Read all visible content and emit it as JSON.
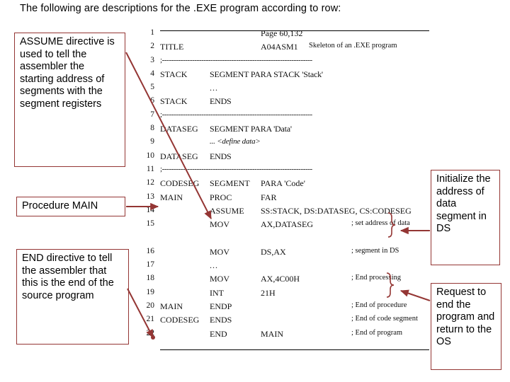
{
  "slide": {
    "title": "The following are descriptions for the .EXE program according to row:",
    "accent_color": "#943634",
    "text_color": "#000000",
    "background_color": "#ffffff"
  },
  "code_listing": {
    "rows": [
      {
        "num": "1",
        "label": "",
        "op": "",
        "arg": "Page 60,132",
        "comment": ""
      },
      {
        "num": "2",
        "label": "TITLE",
        "op": "",
        "arg": "A04ASM1",
        "comment": "Skeleton of an .EXE program"
      },
      {
        "num": "3",
        "label": ";",
        "op": "divider",
        "arg": "",
        "comment": ""
      },
      {
        "num": "4",
        "label": "STACK",
        "op": "",
        "arg": "SEGMENT PARA STACK 'Stack'",
        "comment": ""
      },
      {
        "num": "5",
        "label": "",
        "op": "",
        "arg": "...",
        "comment": ""
      },
      {
        "num": "6",
        "label": "STACK",
        "op": "",
        "arg": "ENDS",
        "comment": ""
      },
      {
        "num": "7",
        "label": ";",
        "op": "divider",
        "arg": "",
        "comment": ""
      },
      {
        "num": "8",
        "label": "DATASEG",
        "op": "",
        "arg": "SEGMENT PARA 'Data'",
        "comment": ""
      },
      {
        "num": "9",
        "label": "",
        "op": "",
        "arg": "... <define data>",
        "comment": ""
      },
      {
        "num": "10",
        "label": "DATASEG",
        "op": "",
        "arg": "ENDS",
        "comment": ""
      },
      {
        "num": "11",
        "label": ";",
        "op": "divider",
        "arg": "",
        "comment": ""
      },
      {
        "num": "12",
        "label": "CODESEG",
        "op": "SEGMENT",
        "arg": "PARA 'Code'",
        "comment": ""
      },
      {
        "num": "13",
        "label": "MAIN",
        "op": "PROC",
        "arg": "FAR",
        "comment": ""
      },
      {
        "num": "14",
        "label": "",
        "op": "ASSUME",
        "arg": "SS:STACK, DS:DATASEG, CS:CODESEG",
        "comment": ""
      },
      {
        "num": "15",
        "label": "",
        "op": "MOV",
        "arg": "AX,DATASEG",
        "comment": "; set address of data"
      },
      {
        "num": "",
        "label": "",
        "op": "",
        "arg": "",
        "comment": ""
      },
      {
        "num": "16",
        "label": "",
        "op": "MOV",
        "arg": "DS,AX",
        "comment": ";      segment in DS"
      },
      {
        "num": "17",
        "label": "",
        "op": "...",
        "arg": "",
        "comment": ""
      },
      {
        "num": "18",
        "label": "",
        "op": "MOV",
        "arg": "AX,4C00H",
        "comment": "; End processing"
      },
      {
        "num": "19",
        "label": "",
        "op": "INT",
        "arg": "21H",
        "comment": ""
      },
      {
        "num": "20",
        "label": "MAIN",
        "op": "ENDP",
        "arg": "",
        "comment": "; End of procedure"
      },
      {
        "num": "21",
        "label": "CODESEG",
        "op": "ENDS",
        "arg": "",
        "comment": "; End of code segment"
      },
      {
        "num": "22",
        "label": "",
        "op": "END",
        "arg": "MAIN",
        "comment": "; End of program"
      }
    ],
    "divider_text": "-----------------------------------------------------------------"
  },
  "callouts": {
    "assume": "ASSUME directive is used to tell the assembler the starting address of segments with the segment registers",
    "procedure": "Procedure MAIN",
    "end": "END directive to tell the assembler that this is the end of the source program",
    "initialize": "Initialize the address of data segment in DS",
    "request": "Request to end the program and return to the OS"
  }
}
